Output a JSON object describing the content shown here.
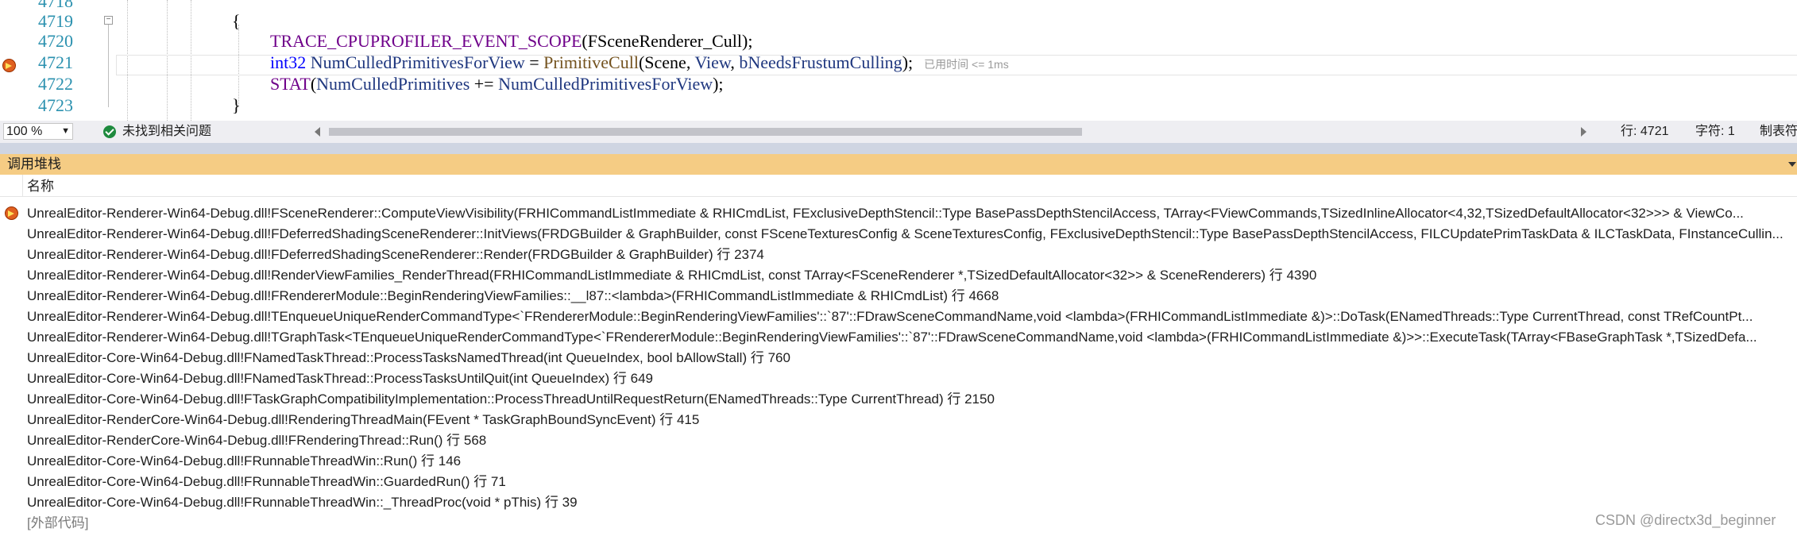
{
  "editor": {
    "lines": [
      {
        "number": "4718"
      },
      {
        "number": "4719",
        "brace": "{"
      },
      {
        "number": "4720",
        "macro": "TRACE_CPUPROFILER_EVENT_SCOPE",
        "p1": "(",
        "arg": "FSceneRenderer_Cull",
        "p2": ");"
      },
      {
        "number": "4721",
        "type": "int32",
        "var": "NumCulledPrimitivesForView",
        "eq": " = ",
        "func": "PrimitiveCull",
        "p1": "(Scene, ",
        "a2": "View",
        "c2": ", ",
        "a3": "bNeedsFrustumCulling",
        "p2": ");",
        "hint": "已用时间 <= 1ms"
      },
      {
        "number": "4722",
        "macro": "STAT",
        "p1": "(",
        "var1": "NumCulledPrimitives",
        "op": " += ",
        "var2": "NumCulledPrimitivesForView",
        "p2": ");"
      },
      {
        "number": "4723",
        "brace": "}"
      }
    ]
  },
  "status_bar": {
    "zoom": "100 %",
    "issues": "未找到相关问题",
    "line": "行: 4721",
    "char": "字符: 1",
    "tabs": "制表符"
  },
  "call_stack": {
    "title": "调用堆栈",
    "column_name": "名称",
    "frames": [
      "UnrealEditor-Renderer-Win64-Debug.dll!FSceneRenderer::ComputeViewVisibility(FRHICommandListImmediate & RHICmdList, FExclusiveDepthStencil::Type BasePassDepthStencilAccess, TArray<FViewCommands,TSizedInlineAllocator<4,32,TSizedDefaultAllocator<32>>> & ViewCo...",
      "UnrealEditor-Renderer-Win64-Debug.dll!FDeferredShadingSceneRenderer::InitViews(FRDGBuilder & GraphBuilder, const FSceneTexturesConfig & SceneTexturesConfig, FExclusiveDepthStencil::Type BasePassDepthStencilAccess, FILCUpdatePrimTaskData & ILCTaskData, FInstanceCullin...",
      "UnrealEditor-Renderer-Win64-Debug.dll!FDeferredShadingSceneRenderer::Render(FRDGBuilder & GraphBuilder) 行 2374",
      "UnrealEditor-Renderer-Win64-Debug.dll!RenderViewFamilies_RenderThread(FRHICommandListImmediate & RHICmdList, const TArray<FSceneRenderer *,TSizedDefaultAllocator<32>> & SceneRenderers) 行 4390",
      "UnrealEditor-Renderer-Win64-Debug.dll!FRendererModule::BeginRenderingViewFamilies::__l87::<lambda>(FRHICommandListImmediate & RHICmdList) 行 4668",
      "UnrealEditor-Renderer-Win64-Debug.dll!TEnqueueUniqueRenderCommandType<`FRendererModule::BeginRenderingViewFamilies'::`87'::FDrawSceneCommandName,void <lambda>(FRHICommandListImmediate &)>::DoTask(ENamedThreads::Type CurrentThread, const TRefCountPt...",
      "UnrealEditor-Renderer-Win64-Debug.dll!TGraphTask<TEnqueueUniqueRenderCommandType<`FRendererModule::BeginRenderingViewFamilies'::`87'::FDrawSceneCommandName,void <lambda>(FRHICommandListImmediate &)>>::ExecuteTask(TArray<FBaseGraphTask *,TSizedDefa...",
      "UnrealEditor-Core-Win64-Debug.dll!FNamedTaskThread::ProcessTasksNamedThread(int QueueIndex, bool bAllowStall) 行 760",
      "UnrealEditor-Core-Win64-Debug.dll!FNamedTaskThread::ProcessTasksUntilQuit(int QueueIndex) 行 649",
      "UnrealEditor-Core-Win64-Debug.dll!FTaskGraphCompatibilityImplementation::ProcessThreadUntilRequestReturn(ENamedThreads::Type CurrentThread) 行 2150",
      "UnrealEditor-RenderCore-Win64-Debug.dll!RenderingThreadMain(FEvent * TaskGraphBoundSyncEvent) 行 415",
      "UnrealEditor-RenderCore-Win64-Debug.dll!FRenderingThread::Run() 行 568",
      "UnrealEditor-Core-Win64-Debug.dll!FRunnableThreadWin::Run() 行 146",
      "UnrealEditor-Core-Win64-Debug.dll!FRunnableThreadWin::GuardedRun() 行 71",
      "UnrealEditor-Core-Win64-Debug.dll!FRunnableThreadWin::_ThreadProc(void * pThis) 行 39",
      "[外部代码]"
    ]
  },
  "watermark": "CSDN @directx3d_beginner",
  "colors": {
    "panel_header": "#f5cc84",
    "line_number": "#2b91af",
    "keyword": "#0000ff",
    "macro": "#6f008a",
    "function": "#74531f",
    "identifier": "#1f377f",
    "breakpoint": "#e06020"
  },
  "icons": {
    "breakpoint_marker": "current-statement-arrow-icon",
    "status_ok": "green-check-icon"
  }
}
